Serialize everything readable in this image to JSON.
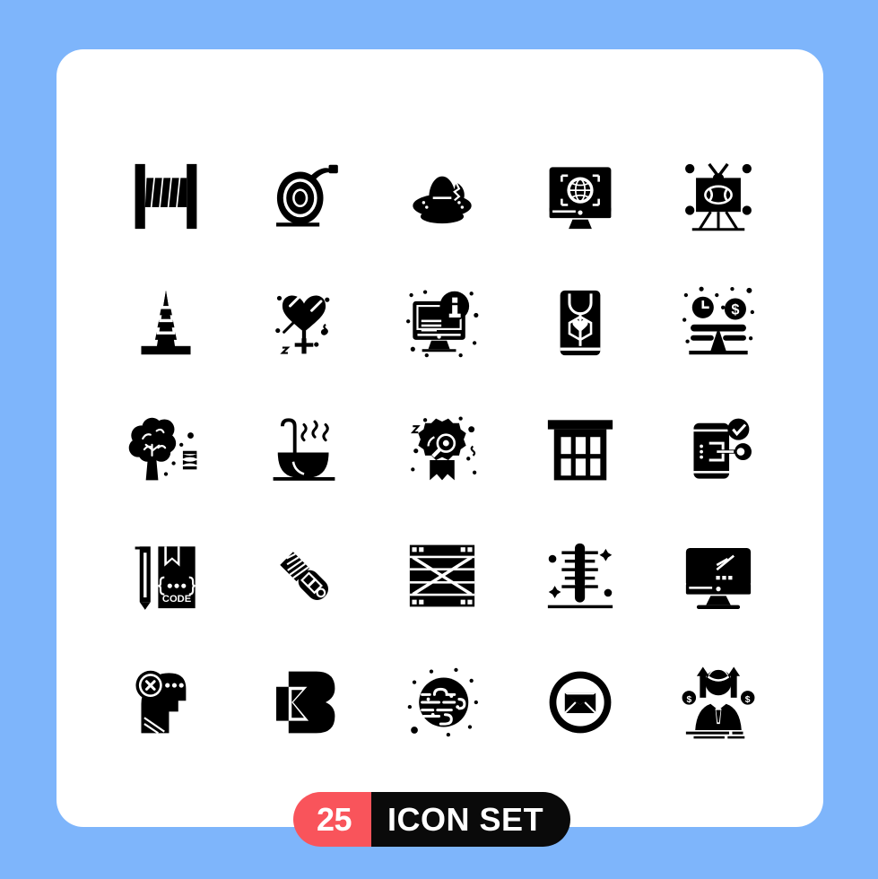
{
  "page": {
    "background_color": "#7EB5FB",
    "card_color": "#FFFFFF"
  },
  "badge": {
    "count": "25",
    "label": "ICON SET",
    "count_bg": "#F9545B",
    "label_bg": "#0A0A0A",
    "text_color": "#FFFFFF"
  },
  "grid": {
    "rows": 5,
    "columns": 5,
    "icon_color": "#000000",
    "icons": [
      {
        "name": "cable-spool-icon",
        "label": "Cable Spool"
      },
      {
        "name": "measuring-tape-icon",
        "label": "Measuring Tape"
      },
      {
        "name": "boiled-egg-icon",
        "label": "Boiled Egg"
      },
      {
        "name": "monitor-globe-icon",
        "label": "Monitor Globe"
      },
      {
        "name": "tv-football-icon",
        "label": "TV Football"
      },
      {
        "name": "traffic-cone-icon",
        "label": "Traffic Cone"
      },
      {
        "name": "heart-female-icon",
        "label": "Heart Female"
      },
      {
        "name": "monitor-info-icon",
        "label": "Monitor Info"
      },
      {
        "name": "mobile-stethoscope-icon",
        "label": "Mobile Stethoscope"
      },
      {
        "name": "time-money-balance-icon",
        "label": "Time Money Balance"
      },
      {
        "name": "tree-dna-icon",
        "label": "Tree DNA"
      },
      {
        "name": "bathtub-icon",
        "label": "Bathtub"
      },
      {
        "name": "award-search-icon",
        "label": "Award Search"
      },
      {
        "name": "building-icon",
        "label": "Building"
      },
      {
        "name": "mobile-login-check-icon",
        "label": "Mobile Login Check"
      },
      {
        "name": "pencil-code-book-icon",
        "label": "Pencil Code Book"
      },
      {
        "name": "cutter-knife-icon",
        "label": "Cutter Knife"
      },
      {
        "name": "wooden-crate-icon",
        "label": "Wooden Crate"
      },
      {
        "name": "thermometer-icon",
        "label": "Thermometer"
      },
      {
        "name": "monitor-chart-icon",
        "label": "Monitor Chart"
      },
      {
        "name": "head-cross-icon",
        "label": "Head Cross"
      },
      {
        "name": "letter-b-logo-icon",
        "label": "Letter B Logo"
      },
      {
        "name": "foggy-planet-icon",
        "label": "Foggy Planet"
      },
      {
        "name": "email-circle-icon",
        "label": "Email Circle"
      },
      {
        "name": "businessman-growth-icon",
        "label": "Businessman Growth"
      }
    ]
  }
}
